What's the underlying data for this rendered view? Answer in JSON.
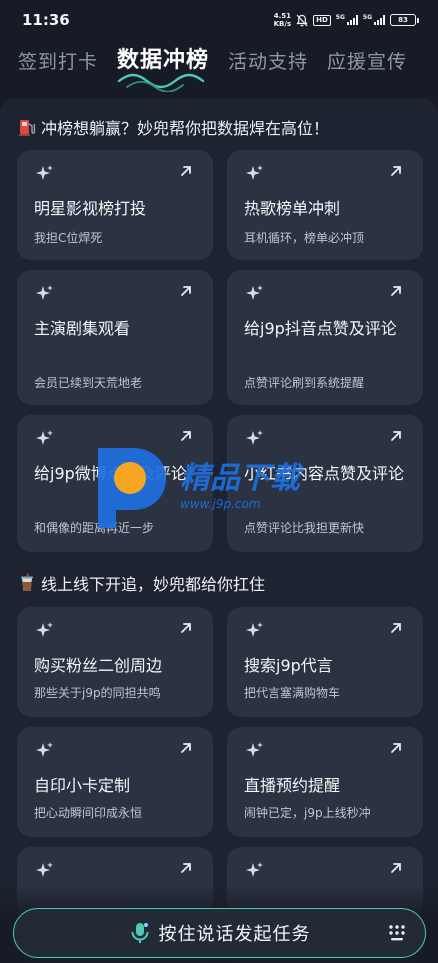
{
  "status_bar": {
    "time": "11:36",
    "net_speed_value": "4.51",
    "net_speed_unit": "KB/s",
    "hd_label": "HD",
    "signal1_label": "5G",
    "signal2_label": "5G",
    "battery": "83"
  },
  "tabs": [
    {
      "label": "签到打卡",
      "active": false
    },
    {
      "label": "数据冲榜",
      "active": true
    },
    {
      "label": "活动支持",
      "active": false
    },
    {
      "label": "应援宣传",
      "active": false
    }
  ],
  "sections": [
    {
      "title": "冲榜想躺赢？妙兜帮你把数据焊在高位！",
      "icon": "fuel-pump-icon",
      "cards": [
        {
          "title": "明星影视榜打投",
          "subtitle": "我担C位焊死"
        },
        {
          "title": "热歌榜单冲刺",
          "subtitle": "耳机循环，榜单必冲顶"
        },
        {
          "title": "主演剧集观看",
          "subtitle": "会员已续到天荒地老"
        },
        {
          "title": "给j9p抖音点赞及评论",
          "subtitle": "点赞评论刷到系统提醒"
        },
        {
          "title": "给j9p微博点赞及评论",
          "subtitle": "和偶像的距离再近一步"
        },
        {
          "title": "小红书内容点赞及评论",
          "subtitle": "点赞评论比我担更新快"
        }
      ]
    },
    {
      "title": "线上线下开追，妙兜都给你扛住",
      "icon": "milk-tea-icon",
      "cards": [
        {
          "title": "购买粉丝二创周边",
          "subtitle": "那些关于j9p的同担共鸣"
        },
        {
          "title": "搜索j9p代言",
          "subtitle": "把代言塞满购物车"
        },
        {
          "title": "自印小卡定制",
          "subtitle": "把心动瞬间印成永恒"
        },
        {
          "title": "直播预约提醒",
          "subtitle": "闹钟已定，j9p上线秒冲"
        },
        {
          "title": "",
          "subtitle": ""
        },
        {
          "title": "",
          "subtitle": ""
        }
      ]
    }
  ],
  "watermark": {
    "brand_text": "精品下载",
    "url_text": "www.j9p.com"
  },
  "voice_bar": {
    "label": "按住说话发起任务"
  },
  "colors": {
    "background": "#161b26",
    "panel": "#1d2330",
    "card": "#2b3241",
    "accent_teal": "#4cc9b9",
    "watermark_blue": "#1e6fe0",
    "watermark_orange": "#f7a623"
  }
}
